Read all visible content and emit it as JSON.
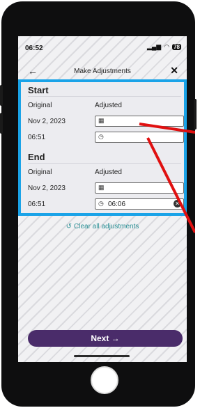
{
  "status_bar": {
    "time": "06:52",
    "signal": "..ll",
    "wifi": "wifi",
    "battery": "78"
  },
  "header": {
    "title": "Make Adjustments",
    "back_icon": "←",
    "close_icon": "✕"
  },
  "start": {
    "title": "Start",
    "original_label": "Original",
    "adjusted_label": "Adjusted",
    "date": "Nov 2, 2023",
    "time": "06:51",
    "adjusted_date": "",
    "adjusted_time": ""
  },
  "end": {
    "title": "End",
    "original_label": "Original",
    "adjusted_label": "Adjusted",
    "date": "Nov 2, 2023",
    "time": "06:51",
    "adjusted_date": "",
    "adjusted_time": "06:06"
  },
  "clear_all": {
    "label": "Clear all adjustments"
  },
  "next": {
    "label": "Next →"
  },
  "colors": {
    "highlight": "#1aa3e8",
    "arrow": "#e01010",
    "accent": "#4a2c6a",
    "link": "#2a8f95"
  }
}
